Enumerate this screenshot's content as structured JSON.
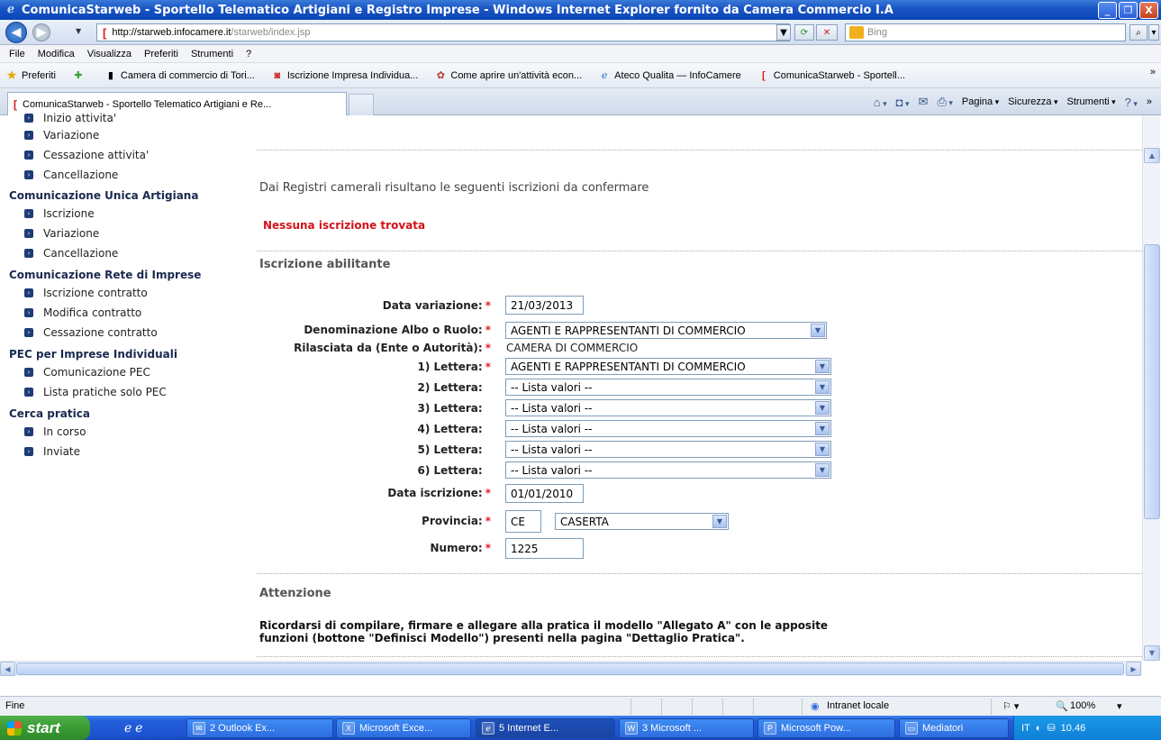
{
  "window": {
    "title": "ComunicaStarweb - Sportello Telematico Artigiani e Registro Imprese - Windows Internet Explorer fornito da Camera Commercio I.A",
    "min": "_",
    "max": "❐",
    "close": "X"
  },
  "address": {
    "url_domain": "http://starweb.infocamere.it",
    "url_path": "/starweb/index.jsp",
    "search_placeholder": "Bing"
  },
  "menu": [
    "File",
    "Modifica",
    "Visualizza",
    "Preferiti",
    "Strumenti",
    "?"
  ],
  "favorites": {
    "label": "Preferiti",
    "items": [
      "Camera di commercio di Tori...",
      "Iscrizione Impresa Individua...",
      "Come aprire un'attività econ...",
      "Ateco Qualita — InfoCamere",
      "ComunicaStarweb - Sportell..."
    ]
  },
  "tab": {
    "label": "ComunicaStarweb - Sportello Telematico Artigiani e Re...",
    "commands": [
      "Pagina",
      "Sicurezza",
      "Strumenti"
    ]
  },
  "sidebar": {
    "top_cut": "Inizio attivita'",
    "group1": [
      "Variazione",
      "Cessazione attivita'",
      "Cancellazione"
    ],
    "head2": "Comunicazione Unica Artigiana",
    "group2": [
      "Iscrizione",
      "Variazione",
      "Cancellazione"
    ],
    "head3": "Comunicazione Rete di Imprese",
    "group3": [
      "Iscrizione contratto",
      "Modifica contratto",
      "Cessazione contratto"
    ],
    "head4": "PEC per Imprese Individuali",
    "group4": [
      "Comunicazione PEC",
      "Lista pratiche solo PEC"
    ],
    "head5": "Cerca pratica",
    "group5": [
      "In corso",
      "Inviate"
    ]
  },
  "main": {
    "registri_title": "Dai Registri camerali risultano le seguenti iscrizioni da confermare",
    "no_results": "Nessuna iscrizione trovata",
    "section_title": "Iscrizione abilitante",
    "fields": {
      "data_variazione_label": "Data variazione:",
      "data_variazione_value": "21/03/2013",
      "denominazione_label": "Denominazione Albo o Ruolo:",
      "denominazione_value": "AGENTI E RAPPRESENTANTI DI COMMERCIO",
      "rilasciata_label": "Rilasciata da (Ente o Autorità):",
      "rilasciata_value": "CAMERA DI COMMERCIO",
      "lettera1_label": "1) Lettera:",
      "lettera1_value": "AGENTI E RAPPRESENTANTI DI COMMERCIO",
      "lettera2_label": "2) Lettera:",
      "lettera3_label": "3) Lettera:",
      "lettera4_label": "4) Lettera:",
      "lettera5_label": "5) Lettera:",
      "lettera6_label": "6) Lettera:",
      "lista_valori": "-- Lista valori --",
      "data_iscrizione_label": "Data iscrizione:",
      "data_iscrizione_value": "01/01/2010",
      "provincia_label": "Provincia:",
      "provincia_code": "CE",
      "provincia_name": "CASERTA",
      "numero_label": "Numero:",
      "numero_value": "1225"
    },
    "required_mark": "*",
    "attention_title": "Attenzione",
    "attention_text_1": "Ricordarsi di compilare, firmare e allegare alla pratica il modello \"Allegato A\" con le apposite",
    "attention_text_2": "funzioni (bottone \"Definisci Modello\") presenti nella pagina \"Dettaglio Pratica\"."
  },
  "status": {
    "left": "Fine",
    "zone": "Intranet locale",
    "zoom": "100%"
  },
  "taskbar": {
    "start": "start",
    "tasks": [
      "2 Outlook Ex...",
      "Microsoft Exce...",
      "5 Internet E...",
      "3 Microsoft ...",
      "Microsoft Pow...",
      "Mediatori"
    ],
    "lang": "IT",
    "clock": "10.46"
  }
}
